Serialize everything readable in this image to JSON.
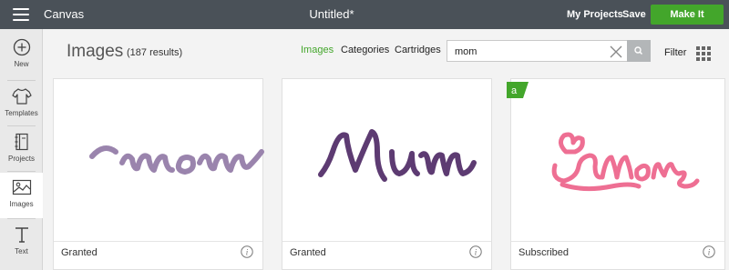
{
  "topbar": {
    "app_name": "Canvas",
    "doc_title": "Untitled*",
    "my_projects": "My Projects",
    "save": "Save",
    "make_it": "Make It",
    "make_it_color": "#43a62b"
  },
  "sidebar": {
    "items": [
      {
        "label": "New",
        "icon": "plus-circle-icon"
      },
      {
        "label": "Templates",
        "icon": "shirt-icon"
      },
      {
        "label": "Projects",
        "icon": "notebook-icon"
      },
      {
        "label": "Images",
        "icon": "image-icon",
        "active": true
      },
      {
        "label": "Text",
        "icon": "text-t-icon"
      }
    ]
  },
  "main": {
    "title": "Images",
    "result_count": "(187 results)",
    "tabs": [
      {
        "label": "Images",
        "active": true
      },
      {
        "label": "Categories",
        "active": false
      },
      {
        "label": "Cartridges",
        "active": false
      }
    ],
    "search": {
      "value": "mom"
    },
    "filter": "Filter"
  },
  "cards": [
    {
      "status": "Granted",
      "image_color": "#9a84ad",
      "badge": ""
    },
    {
      "status": "Granted",
      "image_color": "#5d3b72",
      "badge": ""
    },
    {
      "status": "Subscribed",
      "image_color": "#ee6f93",
      "badge": "a"
    }
  ]
}
